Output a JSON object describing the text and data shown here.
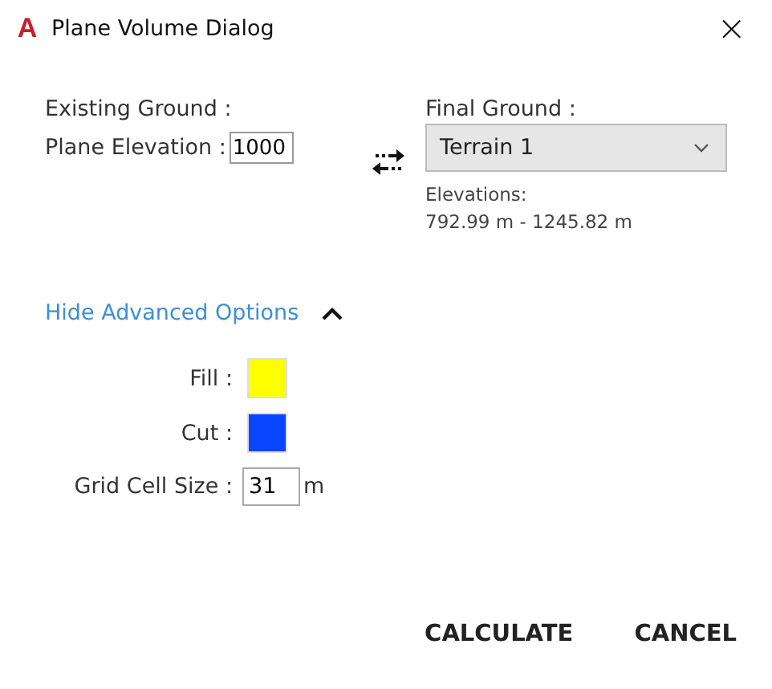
{
  "window": {
    "logo": "A",
    "title": "Plane Volume Dialog",
    "close": "×"
  },
  "existing": {
    "label": "Existing Ground :",
    "elevation_label": "Plane Elevation :",
    "elevation_value": "1000"
  },
  "final": {
    "label": "Final Ground :",
    "selected_value": "Terrain 1",
    "elevations_label": "Elevations:",
    "elevations_range": "792.99 m - 1245.82 m"
  },
  "advanced": {
    "toggle": "Hide Advanced Options",
    "expanded": true,
    "swatches": [
      {
        "label": "Fill :",
        "color": "#ffff00"
      },
      {
        "label": "Cut :",
        "color": "#0a45ff"
      }
    ],
    "grid_label": "Grid Cell Size :",
    "grid_value": "31",
    "grid_unit": "m"
  },
  "buttons": [
    "CALCULATE",
    "CANCEL"
  ]
}
